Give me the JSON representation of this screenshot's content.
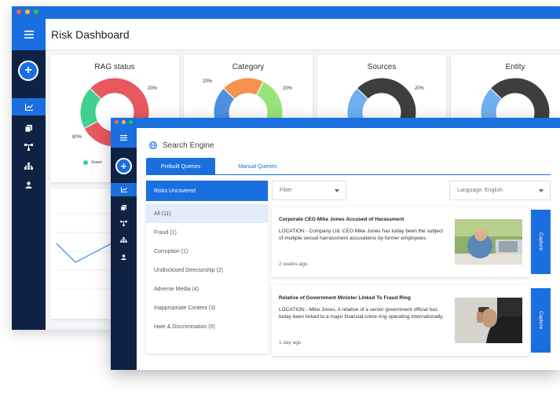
{
  "colors": {
    "accent": "#1a6fe0",
    "sidebar": "#0f2244",
    "green": "#3fcf8e",
    "red": "#e8585f",
    "dark": "#3e3e3e",
    "orange": "#f5924f",
    "light_green": "#98e47c",
    "blue": "#70aef0"
  },
  "back": {
    "title": "Risk Dashboard",
    "menu_icon": "hamburger-icon",
    "cards": [
      {
        "title": "RAG status",
        "labels": [
          "20%",
          "80%"
        ],
        "legend": "Green",
        "segments": [
          {
            "color": "#e8585f",
            "value": 80
          },
          {
            "color": "#3fcf8e",
            "value": 20
          }
        ]
      },
      {
        "title": "Category",
        "labels": [
          "20%",
          "20%"
        ],
        "segments": [
          {
            "color": "#f5924f",
            "value": 20
          },
          {
            "color": "#98e47c",
            "value": 30
          },
          {
            "color": "#70aef0",
            "value": 30
          },
          {
            "color": "#4d8fe3",
            "value": 20
          }
        ]
      },
      {
        "title": "Sources",
        "labels": [
          "20%"
        ],
        "segments": [
          {
            "color": "#3e3e3e",
            "value": 80
          },
          {
            "color": "#70aef0",
            "value": 20
          }
        ]
      },
      {
        "title": "Entity",
        "labels": [],
        "segments": [
          {
            "color": "#3e3e3e",
            "value": 70
          },
          {
            "color": "#70aef0",
            "value": 30
          }
        ]
      }
    ]
  },
  "front": {
    "title": "Search Engine",
    "tabs": [
      {
        "label": "Prebuilt Queries"
      },
      {
        "label": "Manual Queries"
      }
    ],
    "panel_head": "Risks Uncovered",
    "categories": [
      {
        "label": "All (11)"
      },
      {
        "label": "Fraud (1)"
      },
      {
        "label": "Corruption (1)"
      },
      {
        "label": "Undisclosed Directorship (2)"
      },
      {
        "label": "Adverse Media (4)"
      },
      {
        "label": "Inappropriate Content (3)"
      },
      {
        "label": "Hate & Discrimination (0)"
      }
    ],
    "filter_placeholder": "Filter",
    "language": "Language: English",
    "news": [
      {
        "title": "Corporate CEO Mike Jones Accused of Harassment",
        "body": "LOCATION - Company Ltd. CEO Mike Jones has today been the subject of multiple sexual harrassment accusations by former employees.",
        "time": "2 weeks ago",
        "capture": "Capture"
      },
      {
        "title": "Relative of Government Minister Linked To Fraud Ring",
        "body": "LOCATION - Mike Jones, A relative of a senior government official has today been linked to a major financial crime ring operating internationally.",
        "time": "1 day ago",
        "capture": "Capture"
      }
    ]
  }
}
